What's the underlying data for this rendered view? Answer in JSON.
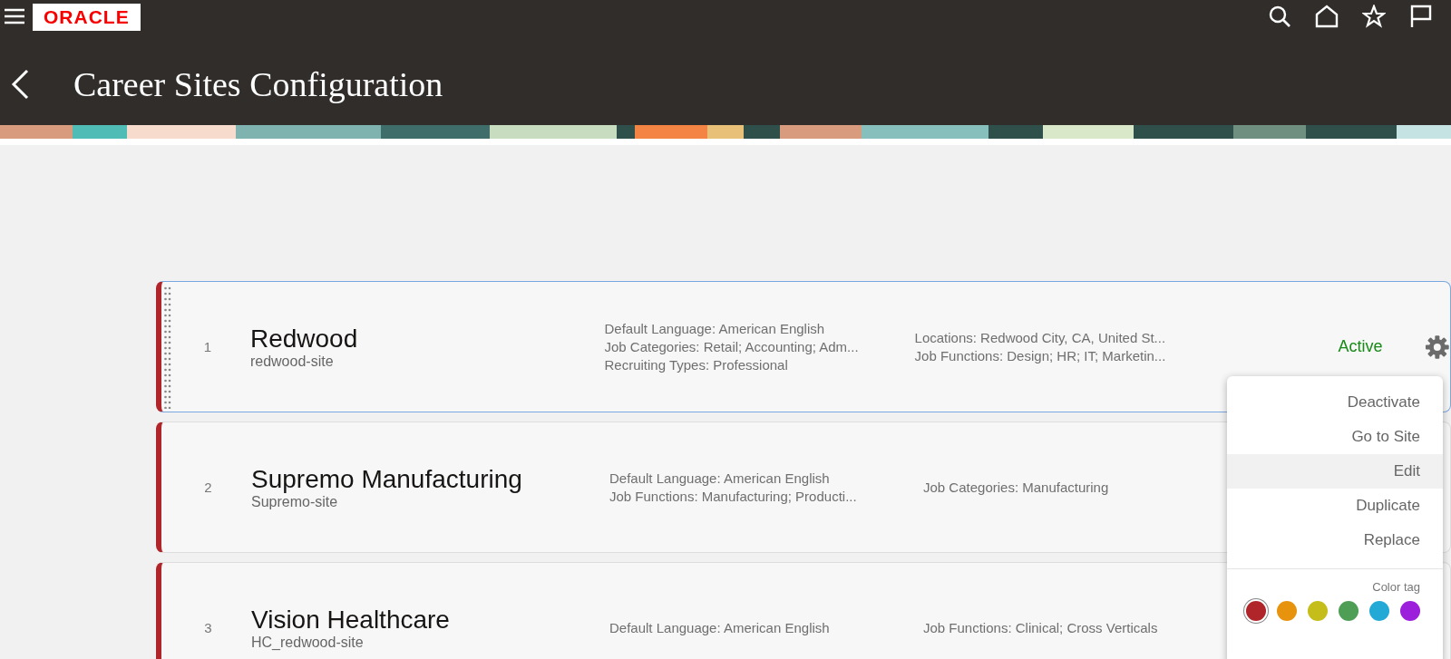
{
  "header": {
    "logo": "ORACLE",
    "title": "Career Sites Configuration"
  },
  "sites": [
    {
      "number": "1",
      "name": "Redwood",
      "slug": "redwood-site",
      "color": "#b0252a",
      "selected": true,
      "details_1": [
        "Default Language: American English",
        "Job Categories: Retail; Accounting; Adm...",
        "Recruiting Types: Professional"
      ],
      "details_2": [
        "Locations: Redwood City, CA, United St...",
        "Job Functions: Design; HR; IT; Marketin..."
      ],
      "status": "Active"
    },
    {
      "number": "2",
      "name": "Supremo Manufacturing",
      "slug": "Supremo-site",
      "color": "#b0252a",
      "selected": false,
      "details_1": [
        "Default Language: American English",
        "Job Functions: Manufacturing; Producti..."
      ],
      "details_2": [
        "Job Categories: Manufacturing"
      ]
    },
    {
      "number": "3",
      "name": "Vision Healthcare",
      "slug": "HC_redwood-site",
      "color": "#b0252a",
      "selected": false,
      "details_1": [
        "Default Language: American English"
      ],
      "details_2": [
        "Job Functions: Clinical; Cross Verticals"
      ]
    }
  ],
  "menu": {
    "items": [
      {
        "label": "Deactivate",
        "selected": false
      },
      {
        "label": "Go to Site",
        "selected": false
      },
      {
        "label": "Edit",
        "selected": true
      },
      {
        "label": "Duplicate",
        "selected": false
      },
      {
        "label": "Replace",
        "selected": false
      }
    ],
    "color_tag_label": "Color tag",
    "color_tags": [
      {
        "color": "#b0252a",
        "selected": true
      },
      {
        "color": "#e8930e",
        "selected": false
      },
      {
        "color": "#c4bd1a",
        "selected": false
      },
      {
        "color": "#4f9e56",
        "selected": false
      },
      {
        "color": "#22a9d6",
        "selected": false
      },
      {
        "color": "#9b1fdb",
        "selected": false
      }
    ]
  }
}
